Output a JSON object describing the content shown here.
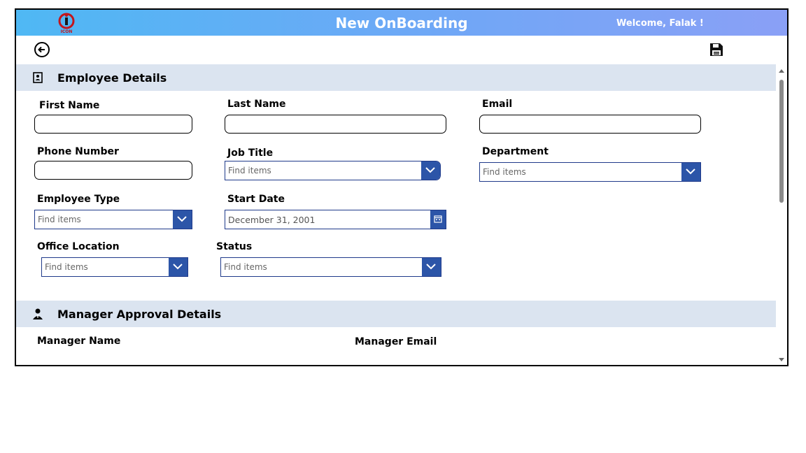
{
  "header": {
    "title": "New OnBoarding",
    "welcome": "Welcome, Falak !",
    "logo_text": "ICON"
  },
  "toolbar": {
    "back_icon": "back-arrow-icon",
    "save_icon": "save-disk-icon"
  },
  "employee_section": {
    "title": "Employee Details",
    "fields": {
      "first_name": {
        "label": "First Name",
        "value": ""
      },
      "last_name": {
        "label": "Last Name",
        "value": ""
      },
      "email": {
        "label": "Email",
        "value": ""
      },
      "phone": {
        "label": "Phone Number",
        "value": ""
      },
      "job_title": {
        "label": "Job Title",
        "placeholder": "Find items"
      },
      "department": {
        "label": "Department",
        "placeholder": "Find items"
      },
      "employee_type": {
        "label": "Employee Type",
        "placeholder": "Find items"
      },
      "start_date": {
        "label": "Start Date",
        "value": "December 31, 2001"
      },
      "office_location": {
        "label": "Office Location",
        "placeholder": "Find items"
      },
      "status": {
        "label": "Status",
        "placeholder": "Find items"
      }
    }
  },
  "manager_section": {
    "title": "Manager Approval Details",
    "manager_name_label": "Manager Name",
    "manager_email_label": "Manager Email"
  },
  "colors": {
    "accent": "#2c55a8",
    "section_bg": "#dbe4f0",
    "header_start": "#4fb8f4",
    "header_end": "#8aa0f6"
  }
}
